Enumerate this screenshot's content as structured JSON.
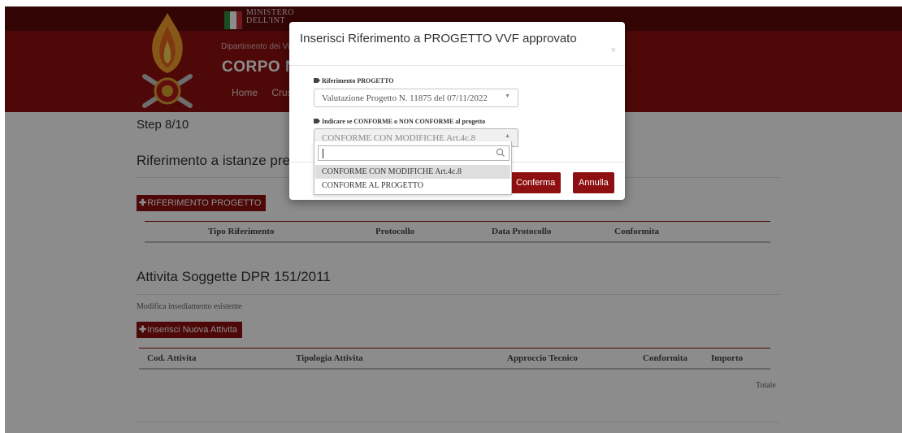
{
  "header": {
    "ministero_line1": "MINISTERO",
    "ministero_line2": "DELL'INT",
    "dipartimento": "Dipartimento dei Vig",
    "corpo": "CORPO NA",
    "nav": [
      "Home",
      "Crus"
    ]
  },
  "page": {
    "step": "Step 8/10",
    "riferimento_title": "Riferimento a istanze precede",
    "riferimento_button": "RIFERIMENTO PROGETTO",
    "riferimento_table_headers": [
      "Tipo Riferimento",
      "Protocollo",
      "Data Protocollo",
      "Conformita"
    ],
    "attivita_title": "Attivita Soggette DPR 151/2011",
    "attivita_subtitle": "Modifica insediamento esistente",
    "attivita_button": "Inserisci Nuova Attivita",
    "attivita_table_headers": [
      "Cod. Attivita",
      "Tipologia Attivita",
      "Approccio Tecnico",
      "Conformita",
      "Importo"
    ],
    "totale": "Totale"
  },
  "modal": {
    "title": "Inserisci Riferimento a PROGETTO VVF approvato",
    "close": "×",
    "field1_label": "Riferimento PROGETTO",
    "field1_value": "Valutazione Progetto N. 11875 del 07/11/2022",
    "field2_label": "Indicare se CONFORME o NON CONFORME al progetto",
    "field2_value": "CONFORME CON MODIFICHE Art.4c.8",
    "confirm_label": "Conferma",
    "cancel_label": "Annulla"
  },
  "dropdown": {
    "search_value": "",
    "options": [
      "CONFORME CON MODIFICHE Art.4c.8",
      "CONFORME AL PROGETTO"
    ],
    "highlighted_index": 0
  },
  "colors": {
    "brand_red": "#8e0f0f",
    "header_dark": "#5f0a0a",
    "overlay": "rgba(0,0,0,0.45)"
  },
  "icons": {
    "emblem": "vvf-flame-emblem",
    "flag": "italian-flag",
    "tag": "tag-icon",
    "plus": "plus-icon",
    "search": "search-icon",
    "chevron": "chevron-down-icon"
  }
}
